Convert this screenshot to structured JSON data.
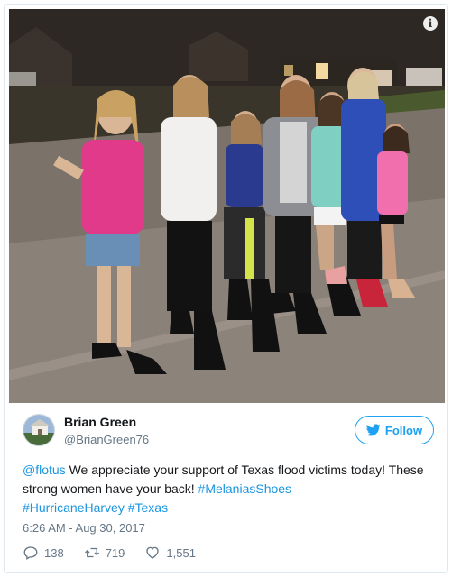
{
  "tweet": {
    "author_name": "Brian Green",
    "author_handle": "@BrianGreen76",
    "follow_label": "Follow",
    "text_parts": {
      "mention": "@flotus",
      "body": " We appreciate your support of Texas flood victims today! These strong women have your back! ",
      "hashtag1": "#MelaniasShoes",
      "hashtag2": "#HurricaneHarvey",
      "space": " ",
      "hashtag3": "#Texas"
    },
    "timestamp": "6:26 AM - Aug 30, 2017",
    "reply_count": "138",
    "retweet_count": "719",
    "like_count": "1,551"
  },
  "photo": {
    "info_icon": "i"
  },
  "icons": {
    "info": "info-icon",
    "follow": "twitter-bird-icon",
    "reply": "reply-icon",
    "retweet": "retweet-icon",
    "like": "heart-icon"
  },
  "colors": {
    "accent": "#1da1f2",
    "link": "#1b95e0",
    "muted": "#657786",
    "border": "#e1e8ed"
  }
}
